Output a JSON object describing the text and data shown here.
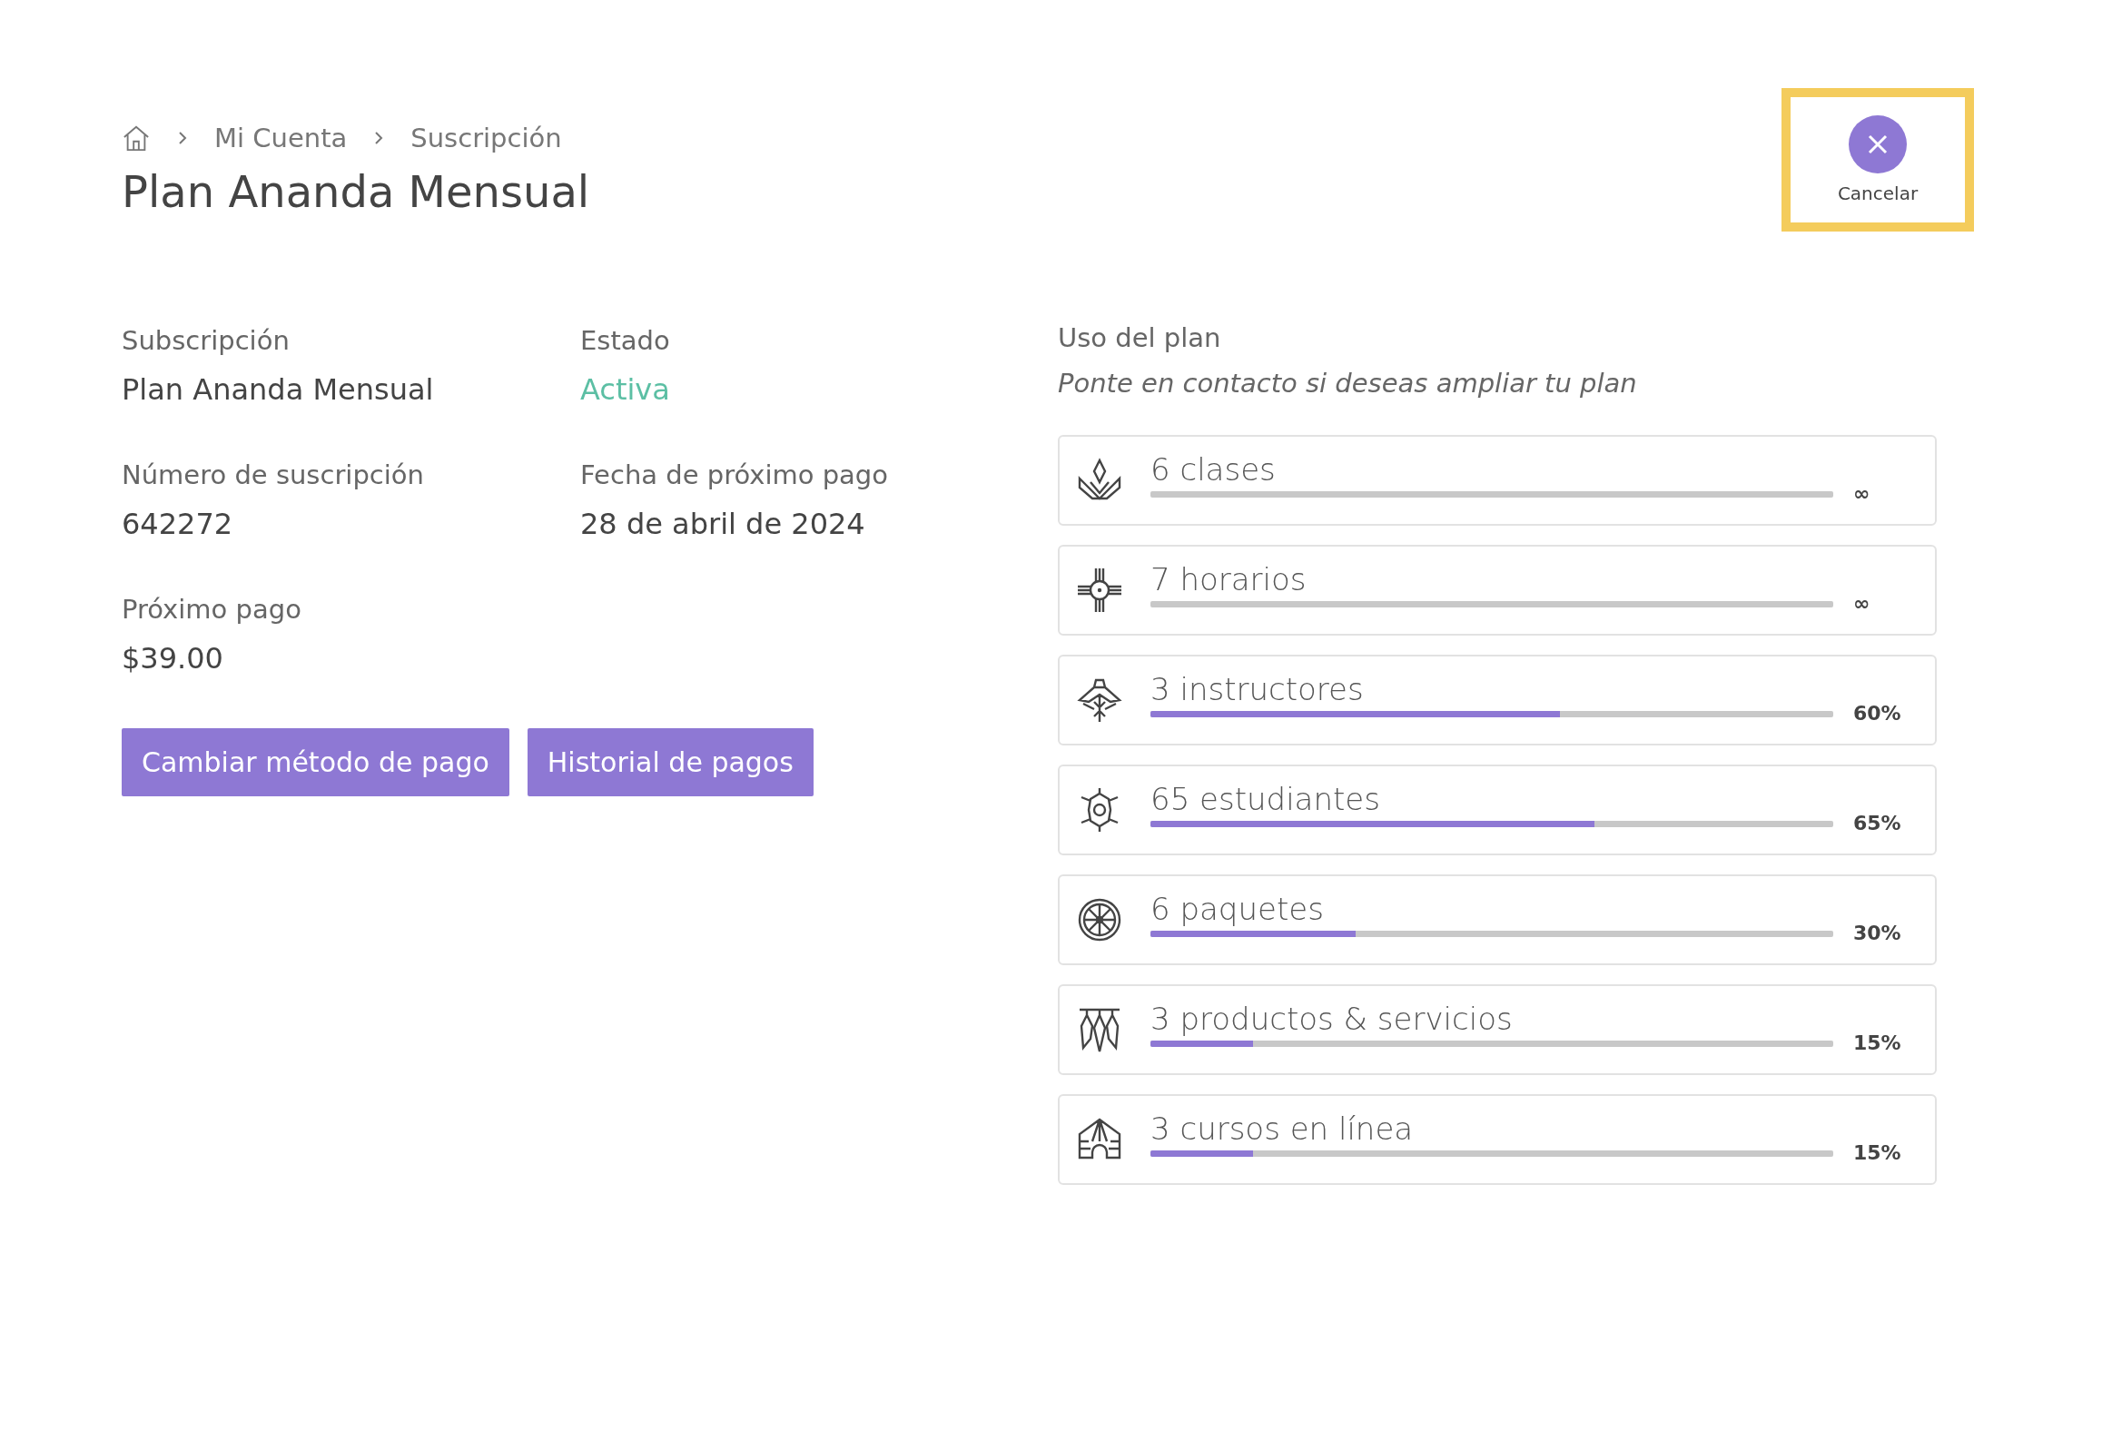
{
  "breadcrumb": [
    "Mi Cuenta",
    "Suscripción"
  ],
  "title": "Plan Ananda Mensual",
  "cancel_button": {
    "label": "Cancelar",
    "highlighted": true
  },
  "details": [
    {
      "label": "Subscripción",
      "value": "Plan Ananda Mensual",
      "kind": "plain"
    },
    {
      "label": "Estado",
      "value": "Activa",
      "kind": "status"
    },
    {
      "label": "Número de suscripción",
      "value": "642272",
      "kind": "plain"
    },
    {
      "label": "Fecha de próximo pago",
      "value": "28 de abril de 2024",
      "kind": "plain"
    },
    {
      "label": "Próximo pago",
      "value": "$39.00",
      "kind": "plain"
    }
  ],
  "buttons": [
    "Cambiar método de pago",
    "Historial de pagos"
  ],
  "usage": {
    "title": "Uso del plan",
    "subtitle": "Ponte en contacto si deseas ampliar tu plan",
    "items": [
      {
        "kind": "lotus",
        "label": "6 clases",
        "reading": "∞"
      },
      {
        "kind": "sun",
        "label": "7 horarios",
        "reading": "∞"
      },
      {
        "kind": "bird",
        "label": "3 instructores",
        "level": 0.6,
        "reading": "60%"
      },
      {
        "kind": "turtle",
        "label": "65 estudiantes",
        "level": 0.65,
        "reading": "65%"
      },
      {
        "kind": "wheel",
        "label": "6 paquetes",
        "level": 0.3,
        "reading": "30%"
      },
      {
        "kind": "feathers",
        "label": "3 productos & servicios",
        "level": 0.15,
        "reading": "15%"
      },
      {
        "kind": "arch",
        "label": "3 cursos en línea",
        "level": 0.15,
        "reading": "15%"
      }
    ]
  }
}
